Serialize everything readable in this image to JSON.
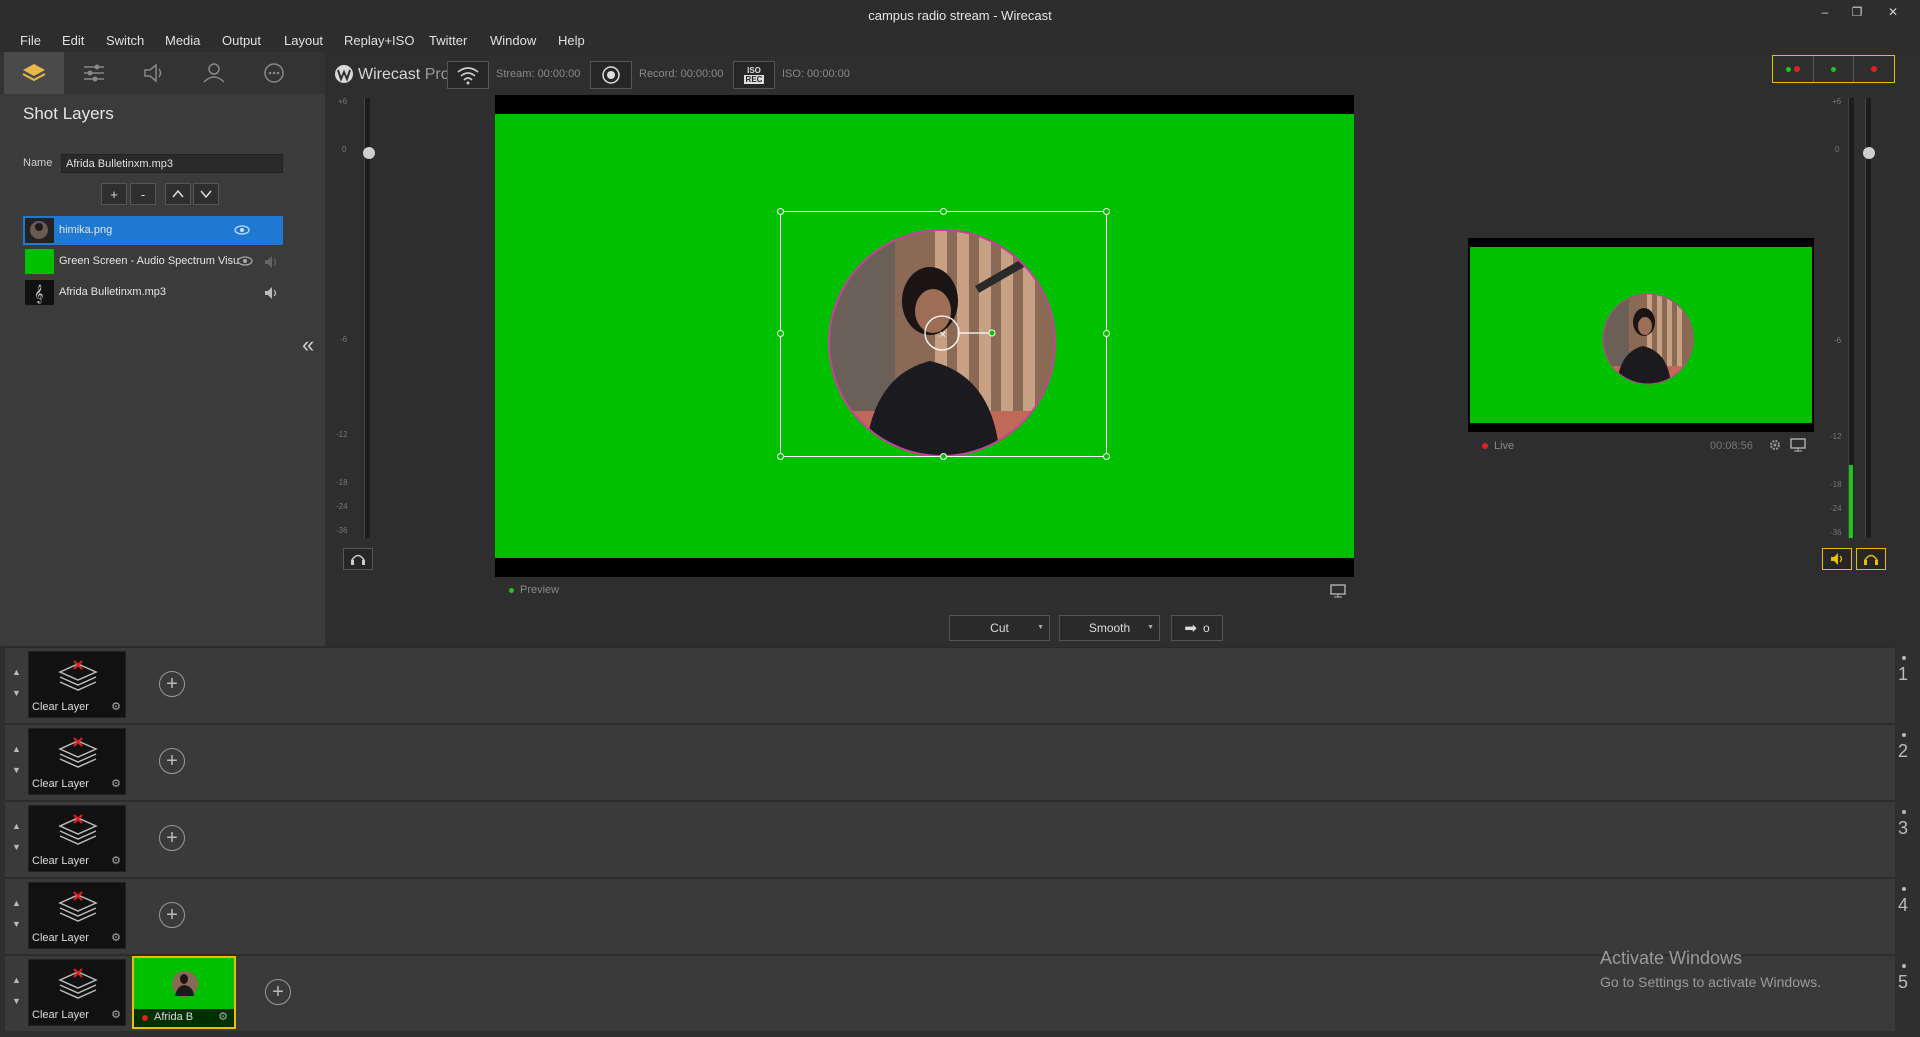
{
  "window": {
    "title": "campus radio stream - Wirecast"
  },
  "menu": [
    "File",
    "Edit",
    "Switch",
    "Media",
    "Output",
    "Layout",
    "Replay+ISO",
    "Twitter",
    "Window",
    "Help"
  ],
  "left_panel": {
    "title": "Shot Layers",
    "name_label": "Name",
    "name_value": "Afrida Bulletinxm.mp3",
    "buttons": [
      "+",
      "-"
    ],
    "layers": [
      {
        "name": "himika.png",
        "selected": true
      },
      {
        "name": "Green Screen - Audio Spectrum Visu",
        "selected": false
      },
      {
        "name": "Afrida Bulletinxm.mp3",
        "selected": false
      }
    ],
    "collapse_glyph": "«"
  },
  "toolbar": {
    "brand": "Wirecast",
    "brand_suffix": "Pro",
    "stream": "Stream: 00:00:00",
    "record": "Record: 00:00:00",
    "iso_badge_top": "ISO",
    "iso_badge_bottom": "REC",
    "iso": "ISO: 00:00:00"
  },
  "meter_left": {
    "labels": [
      "+6",
      "0",
      "-6",
      "-12",
      "-18",
      "-24",
      "-36"
    ]
  },
  "meter_right": {
    "labels": [
      "+6",
      "0",
      "-6",
      "-12",
      "-18",
      "-24",
      "-36"
    ]
  },
  "preview": {
    "label": "Preview"
  },
  "live": {
    "label": "Live",
    "time": "00:08:56"
  },
  "transition": {
    "cut": "Cut",
    "smooth": "Smooth",
    "go_symbol": "o"
  },
  "shot_rows": [
    {
      "num": "1",
      "shots": [
        "Clear Layer"
      ]
    },
    {
      "num": "2",
      "shots": [
        "Clear Layer"
      ]
    },
    {
      "num": "3",
      "shots": [
        "Clear Layer"
      ]
    },
    {
      "num": "4",
      "shots": [
        "Clear Layer"
      ]
    },
    {
      "num": "5",
      "shots": [
        "Clear Layer",
        "Afrida B"
      ]
    }
  ],
  "watermark": {
    "line1": "Activate Windows",
    "line2": "Go to Settings to activate Windows."
  },
  "colors": {
    "green_screen": "#00c000",
    "selection": "#1f78d1",
    "live_outline": "#e8c000"
  }
}
